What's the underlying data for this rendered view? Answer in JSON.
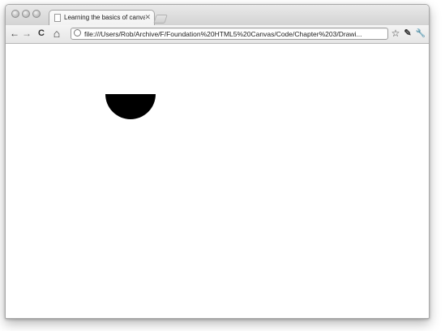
{
  "window": {
    "tab_title": "Learning the basics of canvas",
    "tab_close_glyph": "✕"
  },
  "toolbar": {
    "back_glyph": "←",
    "forward_glyph": "→",
    "reload_glyph": "C",
    "home_glyph": "⌂",
    "url": "file:///Users/Rob/Archive/F/Foundation%20HTML5%20Canvas/Code/Chapter%203/Drawi...",
    "star_glyph": "☆",
    "page_menu_glyph": "✎",
    "wrench_glyph": "🔧"
  },
  "canvas": {
    "shape": "half-circle",
    "fill": "#000000"
  },
  "colors": {
    "titlebar": "#d8d8d8",
    "page_background": "#ffffff"
  }
}
